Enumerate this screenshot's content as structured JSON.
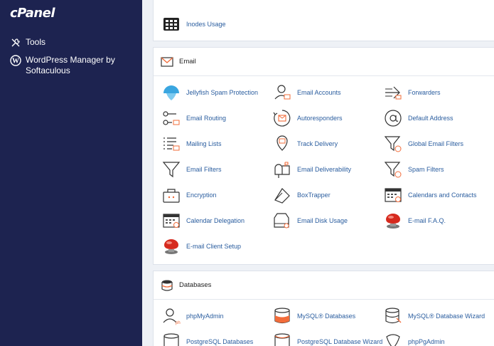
{
  "brand": {
    "logo": "cPanel"
  },
  "sidebar": {
    "items": [
      {
        "label": "Tools",
        "icon": "tools-icon"
      },
      {
        "label": "WordPress Manager by Softaculous",
        "icon": "wordpress-icon"
      }
    ]
  },
  "partial_section": {
    "items": [
      {
        "label": "Inodes Usage",
        "icon": "grid-icon"
      }
    ]
  },
  "email_section": {
    "title": "Email",
    "items": [
      {
        "label": "Jellyfish Spam Protection",
        "icon": "jellyfish-icon"
      },
      {
        "label": "Email Accounts",
        "icon": "email-accounts-icon"
      },
      {
        "label": "Forwarders",
        "icon": "forwarders-icon"
      },
      {
        "label": "Email Routing",
        "icon": "email-routing-icon"
      },
      {
        "label": "Autoresponders",
        "icon": "autoresponders-icon"
      },
      {
        "label": "Default Address",
        "icon": "at-sign-icon"
      },
      {
        "label": "Mailing Lists",
        "icon": "mailing-lists-icon"
      },
      {
        "label": "Track Delivery",
        "icon": "track-delivery-icon"
      },
      {
        "label": "Global Email Filters",
        "icon": "global-filter-icon"
      },
      {
        "label": "Email Filters",
        "icon": "filter-icon"
      },
      {
        "label": "Email Deliverability",
        "icon": "mailbox-icon"
      },
      {
        "label": "Spam Filters",
        "icon": "spam-filter-icon"
      },
      {
        "label": "Encryption",
        "icon": "encryption-icon"
      },
      {
        "label": "BoxTrapper",
        "icon": "boxtrapper-icon"
      },
      {
        "label": "Calendars and Contacts",
        "icon": "calendar-icon"
      },
      {
        "label": "Calendar Delegation",
        "icon": "calendar-delegation-icon"
      },
      {
        "label": "Email Disk Usage",
        "icon": "disk-usage-icon"
      },
      {
        "label": "E-mail F.A.Q.",
        "icon": "help-button-icon"
      },
      {
        "label": "E-mail Client Setup",
        "icon": "help-button-icon"
      }
    ]
  },
  "databases_section": {
    "title": "Databases",
    "items": [
      {
        "label": "phpMyAdmin",
        "icon": "phpmyadmin-icon"
      },
      {
        "label": "MySQL® Databases",
        "icon": "mysql-databases-icon"
      },
      {
        "label": "MySQL® Database Wizard",
        "icon": "mysql-wizard-icon"
      },
      {
        "label": "PostgreSQL Databases",
        "icon": "postgresql-icon"
      },
      {
        "label": "PostgreSQL Database Wizard",
        "icon": "postgresql-wizard-icon"
      },
      {
        "label": "phpPgAdmin",
        "icon": "phppgadmin-icon"
      }
    ]
  },
  "colors": {
    "sidebar_bg": "#1d2350",
    "link": "#2a5d9f",
    "accent": "#f26c3a"
  }
}
